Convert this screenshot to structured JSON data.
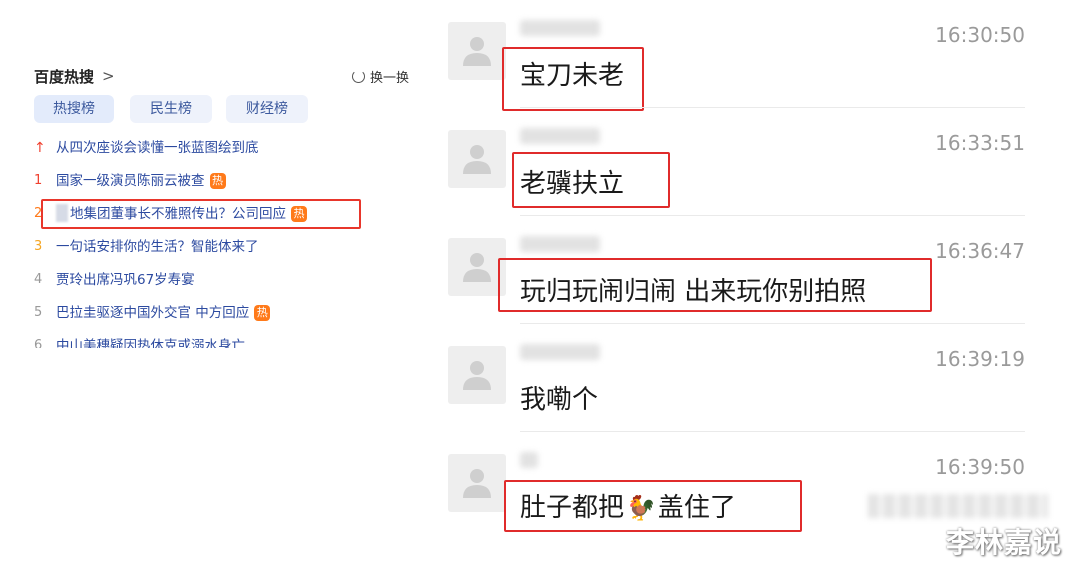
{
  "hot_search": {
    "title": "百度热搜",
    "title_arrow": ">",
    "refresh_label": "换一换",
    "tabs": [
      "热搜榜",
      "民生榜",
      "财经榜"
    ],
    "items": [
      {
        "rank": "↑",
        "text": "从四次座谈会读懂一张蓝图绘到底",
        "hot": false
      },
      {
        "rank": "1",
        "text": "国家一级演员陈丽云被查",
        "hot": true
      },
      {
        "rank": "2",
        "text": "地集团董事长不雅照传出？公司回应",
        "hot": true
      },
      {
        "rank": "3",
        "text": "一句话安排你的生活？智能体来了",
        "hot": false
      },
      {
        "rank": "4",
        "text": "贾玲出席冯巩67岁寿宴",
        "hot": false
      },
      {
        "rank": "5",
        "text": "巴拉圭驱逐中国外交官 中方回应",
        "hot": true
      },
      {
        "rank": "6",
        "text": "中山美穗疑因热休克或溺水身亡",
        "hot": false
      }
    ],
    "hot_badge": "热",
    "colors": {
      "link": "#2c4aa0",
      "accent_red": "#f0402f",
      "badge": "#ff7a1a",
      "highlight_box": "#e8362b"
    }
  },
  "chat": {
    "messages": [
      {
        "time": "16:30:50",
        "text": "宝刀未老"
      },
      {
        "time": "16:33:51",
        "text": "老骥扶立"
      },
      {
        "time": "16:36:47",
        "text": "玩归玩闹归闹 出来玩你别拍照"
      },
      {
        "time": "16:39:19",
        "text": "我嘞个"
      },
      {
        "time": "16:39:50",
        "text_before": "肚子都把",
        "emoji": "🐓",
        "text_after": "盖住了"
      }
    ],
    "colors": {
      "highlight_box": "#e02b2b",
      "time": "#9a9a9a"
    }
  },
  "watermark": "李林嘉说"
}
